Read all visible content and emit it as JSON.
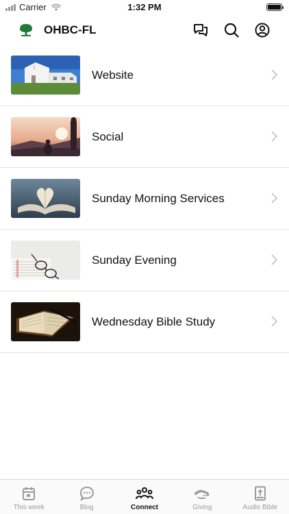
{
  "status_bar": {
    "carrier": "Carrier",
    "time": "1:32 PM"
  },
  "header": {
    "title": "OHBC-FL",
    "logo_icon": "tree-icon",
    "brand_color": "#1f7a3a"
  },
  "list": {
    "items": [
      {
        "label": "Website",
        "thumbnail": "church-building"
      },
      {
        "label": "Social",
        "thumbnail": "sunset-people"
      },
      {
        "label": "Sunday Morning Services",
        "thumbnail": "open-book-heart"
      },
      {
        "label": "Sunday Evening",
        "thumbnail": "glasses-on-bible"
      },
      {
        "label": "Wednesday Bible Study",
        "thumbnail": "bible-with-pen"
      }
    ]
  },
  "tabs": [
    {
      "label": "This week",
      "icon": "calendar-icon",
      "active": false
    },
    {
      "label": "Blog",
      "icon": "chat-bubble-icon",
      "active": false
    },
    {
      "label": "Connect",
      "icon": "people-icon",
      "active": true
    },
    {
      "label": "Giving",
      "icon": "giving-hand-icon",
      "active": false
    },
    {
      "label": "Audio Bible",
      "icon": "bible-icon",
      "active": false
    }
  ]
}
